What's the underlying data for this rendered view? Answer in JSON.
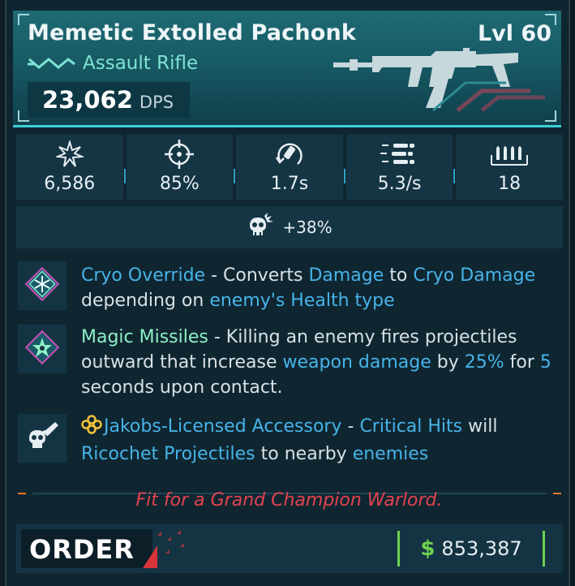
{
  "weapon": {
    "name": "Memetic Extolled Pachonk",
    "level": "Lvl 60",
    "type": "Assault Rifle",
    "dps_value": "23,062",
    "dps_unit": "DPS"
  },
  "stats": [
    {
      "icon": "damage-burst-icon",
      "value": "6,586"
    },
    {
      "icon": "accuracy-crosshair-icon",
      "value": "85%"
    },
    {
      "icon": "reload-time-icon",
      "value": "1.7s"
    },
    {
      "icon": "fire-rate-icon",
      "value": "5.3/s"
    },
    {
      "icon": "magazine-ammo-icon",
      "value": "18"
    }
  ],
  "crit": {
    "icon": "crit-skull-icon",
    "value": "+38%"
  },
  "perks": [
    {
      "icon": "cryo-snowflake-icon",
      "name": "Cryo Override",
      "parts": [
        " - Converts ",
        "Damage",
        " to ",
        "Cryo",
        " ",
        "Damage",
        " depending on ",
        "enemy's Health type"
      ]
    },
    {
      "icon": "magic-missile-star-icon",
      "name": "Magic Missiles",
      "parts": [
        " - Killing an enemy fires projectiles outward that increase ",
        "weapon damage",
        " by ",
        "25%",
        " for ",
        "5",
        " seconds upon contact."
      ]
    },
    {
      "icon": "skull-knife-icon",
      "name": "Jakobs-Licensed Accessory",
      "parts": [
        " - ",
        "Critical Hits",
        " will ",
        "Ricochet Projectiles",
        " to nearby ",
        "enemies"
      ]
    }
  ],
  "flavor_text": "Fit for a Grand Champion Warlord.",
  "manufacturer": "ORDER",
  "price": {
    "symbol": "$",
    "value": "853,387"
  },
  "colors": {
    "accent_cyan": "#3cd0d6",
    "keyword_blue": "#47b3e8",
    "perk_green": "#8ef0c6",
    "flavor_red": "#e2434f",
    "money_green": "#6cd24f",
    "manufacturer_red": "#d8343c"
  }
}
